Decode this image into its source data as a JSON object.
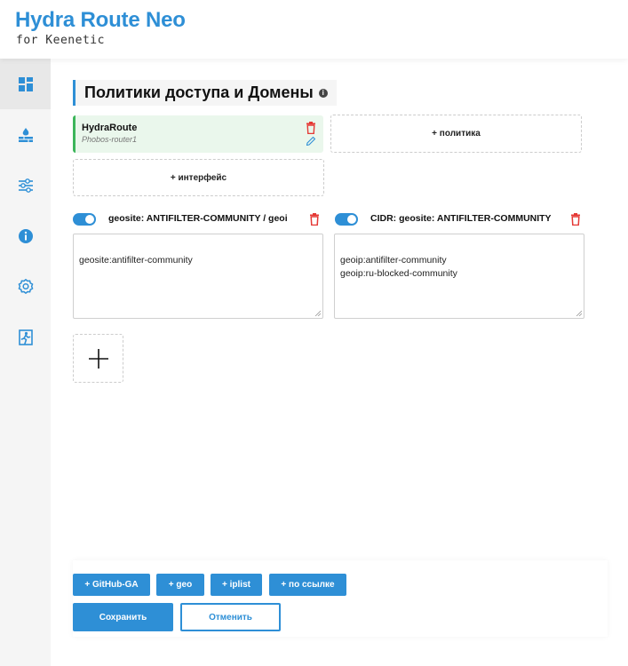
{
  "brand": {
    "title": "Hydra Route Neo",
    "subtitle": "for Keenetic",
    "accent_color": "#2e8fd6"
  },
  "sidebar": {
    "items": [
      {
        "icon": "dashboard-icon",
        "active": true
      },
      {
        "icon": "firewall-icon",
        "active": false
      },
      {
        "icon": "sliders-icon",
        "active": false
      },
      {
        "icon": "info-icon",
        "active": false
      },
      {
        "icon": "gear-icon",
        "active": false
      },
      {
        "icon": "exit-icon",
        "active": false
      }
    ]
  },
  "main": {
    "section_title": "Политики доступа и Домены",
    "interface_card": {
      "name": "HydraRoute",
      "subtitle": "Phobos-router1",
      "color": "#3cb55a"
    },
    "add_policy_label": "+ политика",
    "add_interface_label": "+ интерфейс",
    "groups": [
      {
        "enabled": true,
        "title": "geosite: ANTIFILTER-COMMUNITY / geoi",
        "content": "geosite:antifilter-community"
      },
      {
        "enabled": true,
        "title": "CIDR: geosite: ANTIFILTER-COMMUNITY",
        "content": "geoip:antifilter-community\ngeoip:ru-blocked-community"
      }
    ],
    "delete_color": "#e53935"
  },
  "footer": {
    "chips": [
      "+ GitHub-GA",
      "+ geo",
      "+ iplist",
      "+ по ссылке"
    ],
    "save_label": "Сохранить",
    "cancel_label": "Отменить"
  }
}
